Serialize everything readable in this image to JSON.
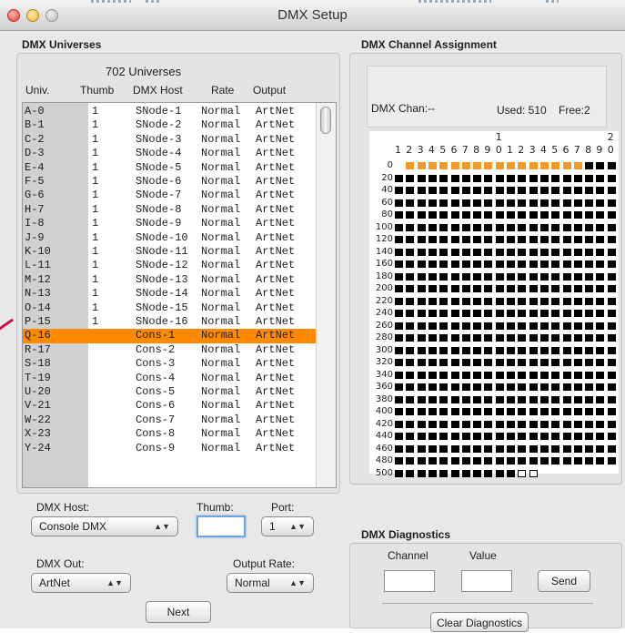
{
  "window": {
    "title": "DMX Setup"
  },
  "universes": {
    "group_title": "DMX Universes",
    "count_label": "702 Universes",
    "headers": [
      "Univ.",
      "Thumb",
      "DMX Host",
      "Rate",
      "Output"
    ],
    "selected_index": 16,
    "rows": [
      [
        "A-0",
        "1",
        "SNode-1",
        "Normal",
        "ArtNet"
      ],
      [
        "B-1",
        "1",
        "SNode-2",
        "Normal",
        "ArtNet"
      ],
      [
        "C-2",
        "1",
        "SNode-3",
        "Normal",
        "ArtNet"
      ],
      [
        "D-3",
        "1",
        "SNode-4",
        "Normal",
        "ArtNet"
      ],
      [
        "E-4",
        "1",
        "SNode-5",
        "Normal",
        "ArtNet"
      ],
      [
        "F-5",
        "1",
        "SNode-6",
        "Normal",
        "ArtNet"
      ],
      [
        "G-6",
        "1",
        "SNode-7",
        "Normal",
        "ArtNet"
      ],
      [
        "H-7",
        "1",
        "SNode-8",
        "Normal",
        "ArtNet"
      ],
      [
        "I-8",
        "1",
        "SNode-9",
        "Normal",
        "ArtNet"
      ],
      [
        "J-9",
        "1",
        "SNode-10",
        "Normal",
        "ArtNet"
      ],
      [
        "K-10",
        "1",
        "SNode-11",
        "Normal",
        "ArtNet"
      ],
      [
        "L-11",
        "1",
        "SNode-12",
        "Normal",
        "ArtNet"
      ],
      [
        "M-12",
        "1",
        "SNode-13",
        "Normal",
        "ArtNet"
      ],
      [
        "N-13",
        "1",
        "SNode-14",
        "Normal",
        "ArtNet"
      ],
      [
        "O-14",
        "1",
        "SNode-15",
        "Normal",
        "ArtNet"
      ],
      [
        "P-15",
        "1",
        "SNode-16",
        "Normal",
        "ArtNet"
      ],
      [
        "Q-16",
        "",
        "Cons-1",
        "Normal",
        "ArtNet"
      ],
      [
        "R-17",
        "",
        "Cons-2",
        "Normal",
        "ArtNet"
      ],
      [
        "S-18",
        "",
        "Cons-3",
        "Normal",
        "ArtNet"
      ],
      [
        "T-19",
        "",
        "Cons-4",
        "Normal",
        "ArtNet"
      ],
      [
        "U-20",
        "",
        "Cons-5",
        "Normal",
        "ArtNet"
      ],
      [
        "V-21",
        "",
        "Cons-6",
        "Normal",
        "ArtNet"
      ],
      [
        "W-22",
        "",
        "Cons-7",
        "Normal",
        "ArtNet"
      ],
      [
        "X-23",
        "",
        "Cons-8",
        "Normal",
        "ArtNet"
      ],
      [
        "Y-24",
        "",
        "Cons-9",
        "Normal",
        "ArtNet"
      ]
    ]
  },
  "controls": {
    "host_label": "DMX Host:",
    "host_value": "Console DMX",
    "thumb_label": "Thumb:",
    "thumb_value": "",
    "port_label": "Port:",
    "port_value": "1",
    "out_label": "DMX Out:",
    "out_value": "ArtNet",
    "rate_label": "Output Rate:",
    "rate_value": "Normal",
    "next_label": "Next",
    "popup_arrows": "▲▼"
  },
  "assignment": {
    "group_title": "DMX Channel Assignment",
    "chan_label": "DMX Chan:--",
    "used_label": "Used: 510",
    "free_label": "Free:2",
    "col_ticks_top": [
      "1",
      "2"
    ],
    "col_ticks": [
      "1",
      "2",
      "3",
      "4",
      "5",
      "6",
      "7",
      "8",
      "9",
      "0",
      "1",
      "2",
      "3",
      "4",
      "5",
      "6",
      "7",
      "8",
      "9",
      "0"
    ],
    "row_ticks": [
      "0",
      "20",
      "40",
      "60",
      "80",
      "100",
      "120",
      "140",
      "160",
      "180",
      "200",
      "220",
      "240",
      "260",
      "280",
      "300",
      "320",
      "340",
      "360",
      "380",
      "400",
      "420",
      "440",
      "460",
      "480",
      "500"
    ],
    "highlight_row": 0,
    "highlight_cols_start": 1,
    "highlight_cols_end": 16,
    "used_channels": 510,
    "total_channels": 512,
    "used_color": "#f09a28"
  },
  "diagnostics": {
    "group_title": "DMX Diagnostics",
    "channel_label": "Channel",
    "value_label": "Value",
    "channel_value": "",
    "value_value": "",
    "send_label": "Send",
    "clear_label": "Clear Diagnostics"
  }
}
